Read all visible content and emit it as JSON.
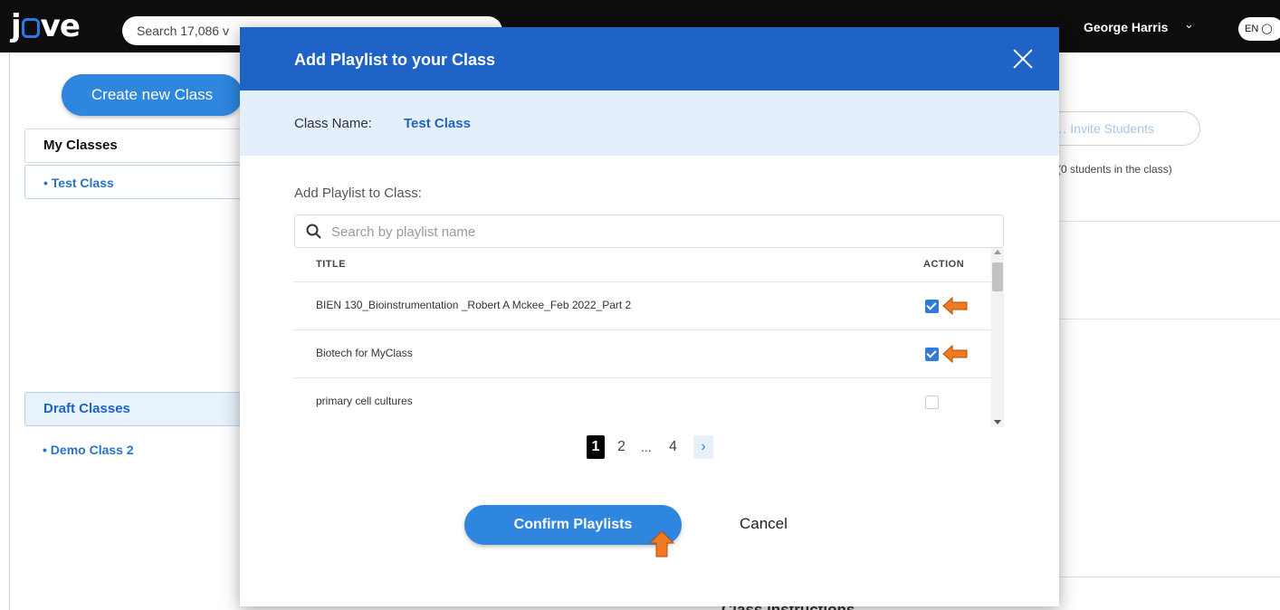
{
  "topbar": {
    "logo": "jove",
    "search_text": "Search 17,086 v",
    "user_name": "George Harris",
    "lang": "EN"
  },
  "sidebar": {
    "create_button": "Create new Class",
    "my_classes_header": "My Classes",
    "my_classes": [
      "Test Class"
    ],
    "draft_classes_header": "Draft Classes",
    "draft_classes": [
      "Demo Class 2"
    ]
  },
  "background": {
    "invite_button": "Invite Students",
    "students_count": "(0 students in the class)",
    "peek_text": "Class Instructions"
  },
  "modal": {
    "title": "Add Playlist to your Class",
    "class_name_label": "Class Name:",
    "class_name_value": "Test Class",
    "add_label": "Add Playlist to Class:",
    "search_placeholder": "Search by playlist name",
    "table": {
      "headers": {
        "title": "TITLE",
        "action": "ACTION"
      },
      "rows": [
        {
          "title": "BIEN 130_Bioinstrumentation _Robert A Mckee_Feb 2022_Part 2",
          "checked": true
        },
        {
          "title": "Biotech for MyClass",
          "checked": true
        },
        {
          "title": "primary cell cultures",
          "checked": false
        }
      ]
    },
    "pagination": {
      "current": "1",
      "page2": "2",
      "ellipsis": "...",
      "last": "4",
      "next": "›"
    },
    "confirm_button": "Confirm Playlists",
    "cancel_button": "Cancel"
  },
  "colors": {
    "accent": "#1e63c5",
    "button": "#2e86de",
    "annotation_arrow": "#f07a22"
  }
}
